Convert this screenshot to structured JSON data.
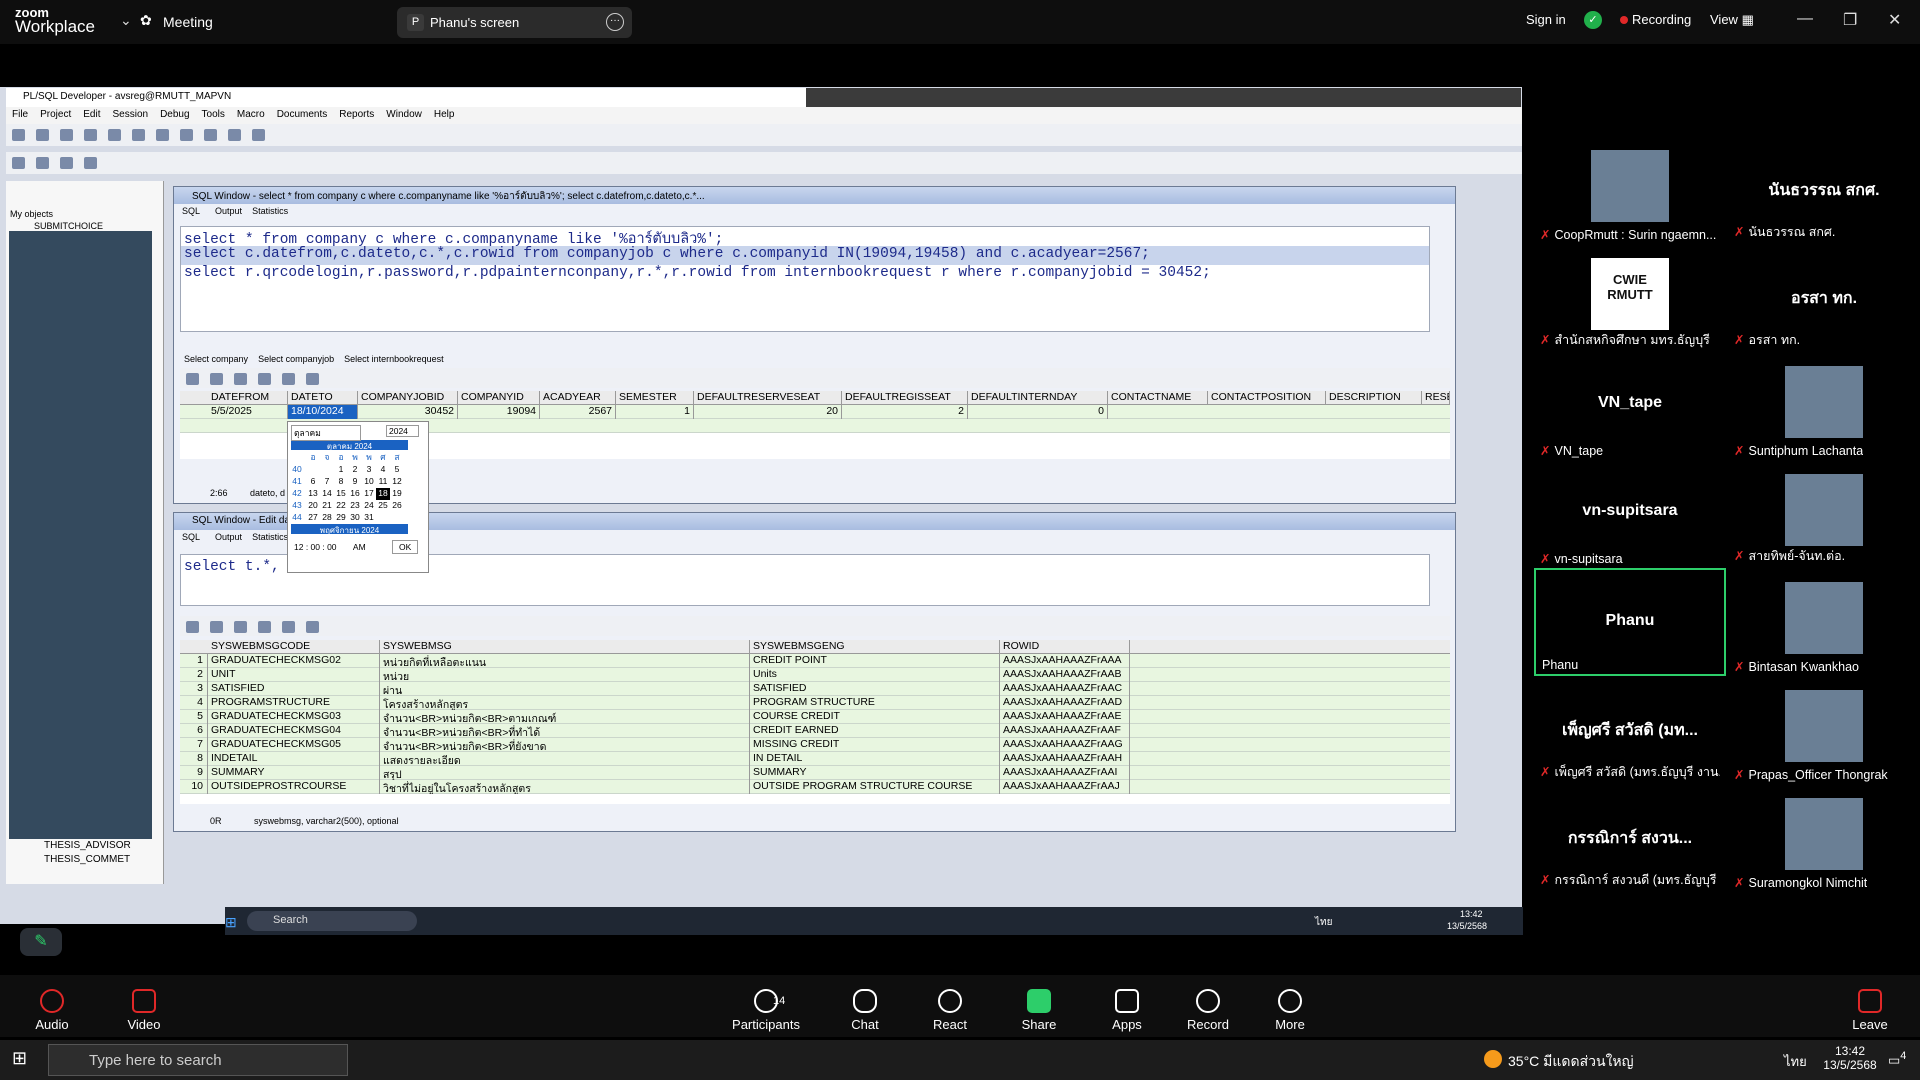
{
  "zoom": {
    "brand_line1": "zoom",
    "brand_line2": "Workplace",
    "meeting_label": "Meeting",
    "screen_badge": "P",
    "screen_title": "Phanu's screen",
    "signin": "Sign in",
    "recording": "Recording",
    "view": "View"
  },
  "app": {
    "title": "PL/SQL Developer - avsreg@RMUTT_MAPVN",
    "menu": [
      "File",
      "Project",
      "Edit",
      "Session",
      "Debug",
      "Tools",
      "Macro",
      "Documents",
      "Reports",
      "Window",
      "Help"
    ]
  },
  "left_pane": {
    "combo": "My objects",
    "top_item": "SUBMITCHOICE",
    "bottom_items": [
      "THESIS_ADVISOR",
      "THESIS_COMMET"
    ]
  },
  "sql1": {
    "title": "SQL Window - select * from company c where c.companyname like '%อาร์ตับบลิว%'; select c.datefrom,c.dateto,c.*...",
    "tabs": [
      "SQL",
      "Output",
      "Statistics"
    ],
    "lines": [
      "select * from company c where c.companyname like '%อาร์ตับบลิว%';",
      "select c.datefrom,c.dateto,c.*,c.rowid from companyjob c where c.companyid IN(19094,19458) and c.acadyear=2567;",
      "select r.qrcodelogin,r.password,r.pdpainternconpany,r.*,r.rowid from internbookrequest r where r.companyjobid = 30452;"
    ],
    "result_tabs": [
      "Select company",
      "Select companyjob",
      "Select internbookrequest"
    ],
    "columns": [
      "DATEFROM",
      "DATETO",
      "COMPANYJOBID",
      "COMPANYID",
      "ACADYEAR",
      "SEMESTER",
      "DEFAULTRESERVESEAT",
      "DEFAULTREGISSEAT",
      "DEFAULTINTERNDAY",
      "CONTACTNAME",
      "CONTACTPOSITION",
      "DESCRIPTION",
      "RESE"
    ],
    "row": [
      "5/5/2025",
      "18/10/2024",
      "30452",
      "19094",
      "2567",
      "1",
      "20",
      "2",
      "0"
    ],
    "status_time": "2:66",
    "status_field": "dateto, d"
  },
  "calendar": {
    "month_select": "ตุลาคม",
    "year": "2024",
    "month_title": "ตุลาคม 2024",
    "day_heads": [
      "อ",
      "จ",
      "อ",
      "พ",
      "พ",
      "ศ",
      "ส"
    ],
    "weeks": [
      {
        "wk": "40",
        "days": [
          "",
          "",
          "1",
          "2",
          "3",
          "4",
          "5"
        ]
      },
      {
        "wk": "41",
        "days": [
          "6",
          "7",
          "8",
          "9",
          "10",
          "11",
          "12"
        ]
      },
      {
        "wk": "42",
        "days": [
          "13",
          "14",
          "15",
          "16",
          "17",
          "18",
          "19"
        ]
      },
      {
        "wk": "43",
        "days": [
          "20",
          "21",
          "22",
          "23",
          "24",
          "25",
          "26"
        ]
      },
      {
        "wk": "44",
        "days": [
          "27",
          "28",
          "29",
          "30",
          "31",
          "",
          ""
        ]
      }
    ],
    "next_month": "พฤศจิกายน 2024",
    "time": "12 : 00 : 00",
    "ampm": "AM",
    "ok": "OK"
  },
  "sql2": {
    "title": "SQL Window - Edit dat...MAPVN",
    "tabs": [
      "SQL",
      "Output",
      "Statistics"
    ],
    "query": "select t.*, t.row",
    "columns": [
      "SYSWEBMSGCODE",
      "SYSWEBMSG",
      "SYSWEBMSGENG",
      "ROWID"
    ],
    "rows": [
      [
        "1",
        "GRADUATECHECKMSG02",
        "หน่วยกิตที่เหลือตะแนน",
        "CREDIT POINT",
        "AAASJxAAHAAAZFrAAA"
      ],
      [
        "2",
        "UNIT",
        "หน่วย",
        "Units",
        "AAASJxAAHAAAZFrAAB"
      ],
      [
        "3",
        "SATISFIED",
        "ผ่าน",
        "SATISFIED",
        "AAASJxAAHAAAZFrAAC"
      ],
      [
        "4",
        "PROGRAMSTRUCTURE",
        "โครงสร้างหลักสูตร",
        "PROGRAM STRUCTURE",
        "AAASJxAAHAAAZFrAAD"
      ],
      [
        "5",
        "GRADUATECHECKMSG03",
        "จำนวน<BR>หน่วยกิต<BR>ตามเกณฑ์",
        "COURSE CREDIT",
        "AAASJxAAHAAAZFrAAE"
      ],
      [
        "6",
        "GRADUATECHECKMSG04",
        "จำนวน<BR>หน่วยกิต<BR>ที่ทำได้",
        "CREDIT EARNED",
        "AAASJxAAHAAAZFrAAF"
      ],
      [
        "7",
        "GRADUATECHECKMSG05",
        "จำนวน<BR>หน่วยกิต<BR>ที่ยังขาด",
        "MISSING CREDIT",
        "AAASJxAAHAAAZFrAAG"
      ],
      [
        "8",
        "INDETAIL",
        "แสดงรายละเอียด",
        "IN DETAIL",
        "AAASJxAAHAAAZFrAAH"
      ],
      [
        "9",
        "SUMMARY",
        "สรุป",
        "SUMMARY",
        "AAASJxAAHAAAZFrAAI"
      ],
      [
        "10",
        "OUTSIDEPROSTRCOURSE",
        "วิชาที่ไม่อยู่ในโครงสร้างหลักสูตร",
        "OUTSIDE PROGRAM STRUCTURE COURSE",
        "AAASJxAAHAAAZFrAAJ"
      ]
    ],
    "status_rows": "0R",
    "status_field": "syswebmsg, varchar2(500), optional"
  },
  "win_taskbar_inner": {
    "search": "Search",
    "time": "13:42",
    "date": "13/5/2568",
    "lang": "ไทย"
  },
  "gallery": [
    {
      "name": "CoopRmutt : Surin ngaemn...",
      "big": "",
      "video": true
    },
    {
      "name": "นันธวรรณ สกศ.",
      "big": "นันธวรรณ สกศ.",
      "video": false
    },
    {
      "name": "สำนักสหกิจศึกษา มทร.ธัญบุรี",
      "big": "",
      "video": true,
      "logo": "CWIE RMUTT"
    },
    {
      "name": "อรสา ทก.",
      "big": "อรสา ทก.",
      "video": false
    },
    {
      "name": "VN_tape",
      "big": "VN_tape",
      "video": false
    },
    {
      "name": "Suntiphum Lachanta",
      "big": "",
      "video": true
    },
    {
      "name": "vn-supitsara",
      "big": "vn-supitsara",
      "video": false
    },
    {
      "name": "สายทิพย์-จันท.ต่อ.",
      "big": "",
      "video": true
    },
    {
      "name": "Phanu",
      "big": "Phanu",
      "video": false,
      "active": true
    },
    {
      "name": "Bintasan Kwankhao",
      "big": "",
      "video": true
    },
    {
      "name": "เพ็ญศรี สวัสดิ (มทร.ธัญบุรี งาน...",
      "big": "เพ็ญศรี สวัสดิ (มท...",
      "video": false
    },
    {
      "name": "Prapas_Officer Thongrak",
      "big": "",
      "video": true
    },
    {
      "name": "กรรณิการ์ สงวนดี (มทร.ธัญบุรี ...",
      "big": "กรรณิการ์ สงวน...",
      "video": false
    },
    {
      "name": "Suramongkol Nimchit",
      "big": "",
      "video": true
    }
  ],
  "controls": {
    "audio": "Audio",
    "video": "Video",
    "participants": "Participants",
    "participants_count": "14",
    "chat": "Chat",
    "react": "React",
    "share": "Share",
    "apps": "Apps",
    "record": "Record",
    "more": "More",
    "leave": "Leave"
  },
  "windows": {
    "search_placeholder": "Type here to search",
    "weather": "35°C มีแดดส่วนใหญ่",
    "lang": "ไทย",
    "time": "13:42",
    "date": "13/5/2568",
    "notif_count": "4"
  }
}
